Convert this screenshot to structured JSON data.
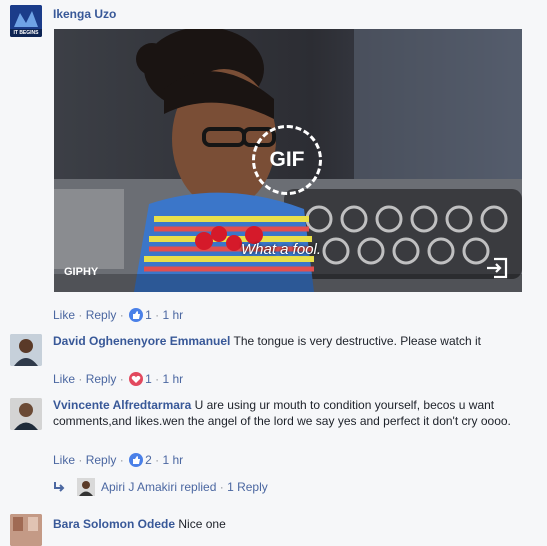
{
  "comments": [
    {
      "author": "Ikenga Uzo",
      "avatar_caption": "IT BEGINS",
      "gif": {
        "badge": "GIF",
        "caption": "What a fool.",
        "source": "GIPHY"
      },
      "actions": {
        "like": "Like",
        "reply": "Reply",
        "reaction_count": "1",
        "time": "1 hr"
      }
    },
    {
      "author": "David Oghenenyore Emmanuel",
      "text": "The tongue is very destructive. Please watch it",
      "actions": {
        "like": "Like",
        "reply": "Reply",
        "reaction_count": "1",
        "time": "1 hr"
      }
    },
    {
      "author": "Vvincente Alfredtarmara",
      "text": "U are using ur mouth to condition yourself, becos u want comments,and likes.wen the angel of the lord we say yes and perfect it don't cry oooo.",
      "actions": {
        "like": "Like",
        "reply": "Reply",
        "reaction_count": "2",
        "time": "1 hr"
      },
      "replies": {
        "replier": "Apiri J Amakiri",
        "replied_label": "replied",
        "reply_count_label": "1 Reply"
      }
    },
    {
      "author": "Bara Solomon Odede",
      "text": "Nice one"
    }
  ],
  "separator": "·",
  "colors": {
    "link": "#385898",
    "like_blue": "#4a80e8",
    "love_red": "#e2495e",
    "background": "#f6f7f9"
  }
}
